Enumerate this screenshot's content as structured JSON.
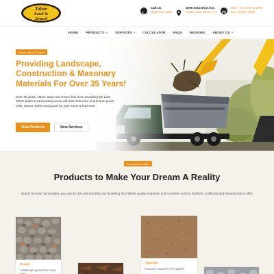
{
  "header": {
    "logo": {
      "line1": "Tahoe",
      "line2": "Sand &",
      "line3": "Gravel"
    },
    "call": {
      "label": "Call Us",
      "value": "(530) 541-6660"
    },
    "address": {
      "label": "1096 Industrial Ave,",
      "value": "South Lake Tahoe, CA"
    },
    "hours": {
      "label": "Mon - Fri: 8AM to 5PM",
      "value": "Sat: 8AM to 2PM"
    }
  },
  "nav": {
    "items": [
      {
        "label": "HOME",
        "has_menu": false
      },
      {
        "label": "PRODUCTS",
        "has_menu": true
      },
      {
        "label": "SERVICES",
        "has_menu": true
      },
      {
        "label": "CALCULATOR",
        "has_menu": false
      },
      {
        "label": "FAQS",
        "has_menu": false
      },
      {
        "label": "REVIEWS",
        "has_menu": false
      },
      {
        "label": "ABOUT US",
        "has_menu": true
      }
    ]
  },
  "hero": {
    "tag": "Tahoe Sand & Gravel",
    "title": "Providing Landscape, Construction & Masonary Materials For Over 35 Years!",
    "body": "Over 35 years, Tahoe Sand and Gravel has been providing the Lake Tahoe basin & surrounding areas with fast deliveries of premium grade soils, stones, barks and gravel for your home & business.",
    "primary_button": "View Products",
    "secondary_button": "View Services"
  },
  "products": {
    "tag": "Products We Offer",
    "title": "Products to Make Your Dream A Reality",
    "intro": "Gravel for your next project, you can be rest assured that you're getting the highest quality materials and customer service Northern California and Nevada has to offer.",
    "cards": [
      {
        "name": "Gravel",
        "desc": "Landscape gravel has many uses"
      },
      {
        "name": "",
        "desc": ""
      },
      {
        "name": "Topsoils",
        "desc": "Premium Topsoil is the highest"
      },
      {
        "name": "",
        "desc": ""
      }
    ]
  },
  "colors": {
    "accent": "#e8901a",
    "dark": "#222222",
    "section_bg": "#f5f2ec"
  },
  "icons": {
    "call": "phone-icon",
    "address": "map-pin-icon",
    "hours": "clock-icon",
    "menu_caret": "chevron-down-icon"
  }
}
